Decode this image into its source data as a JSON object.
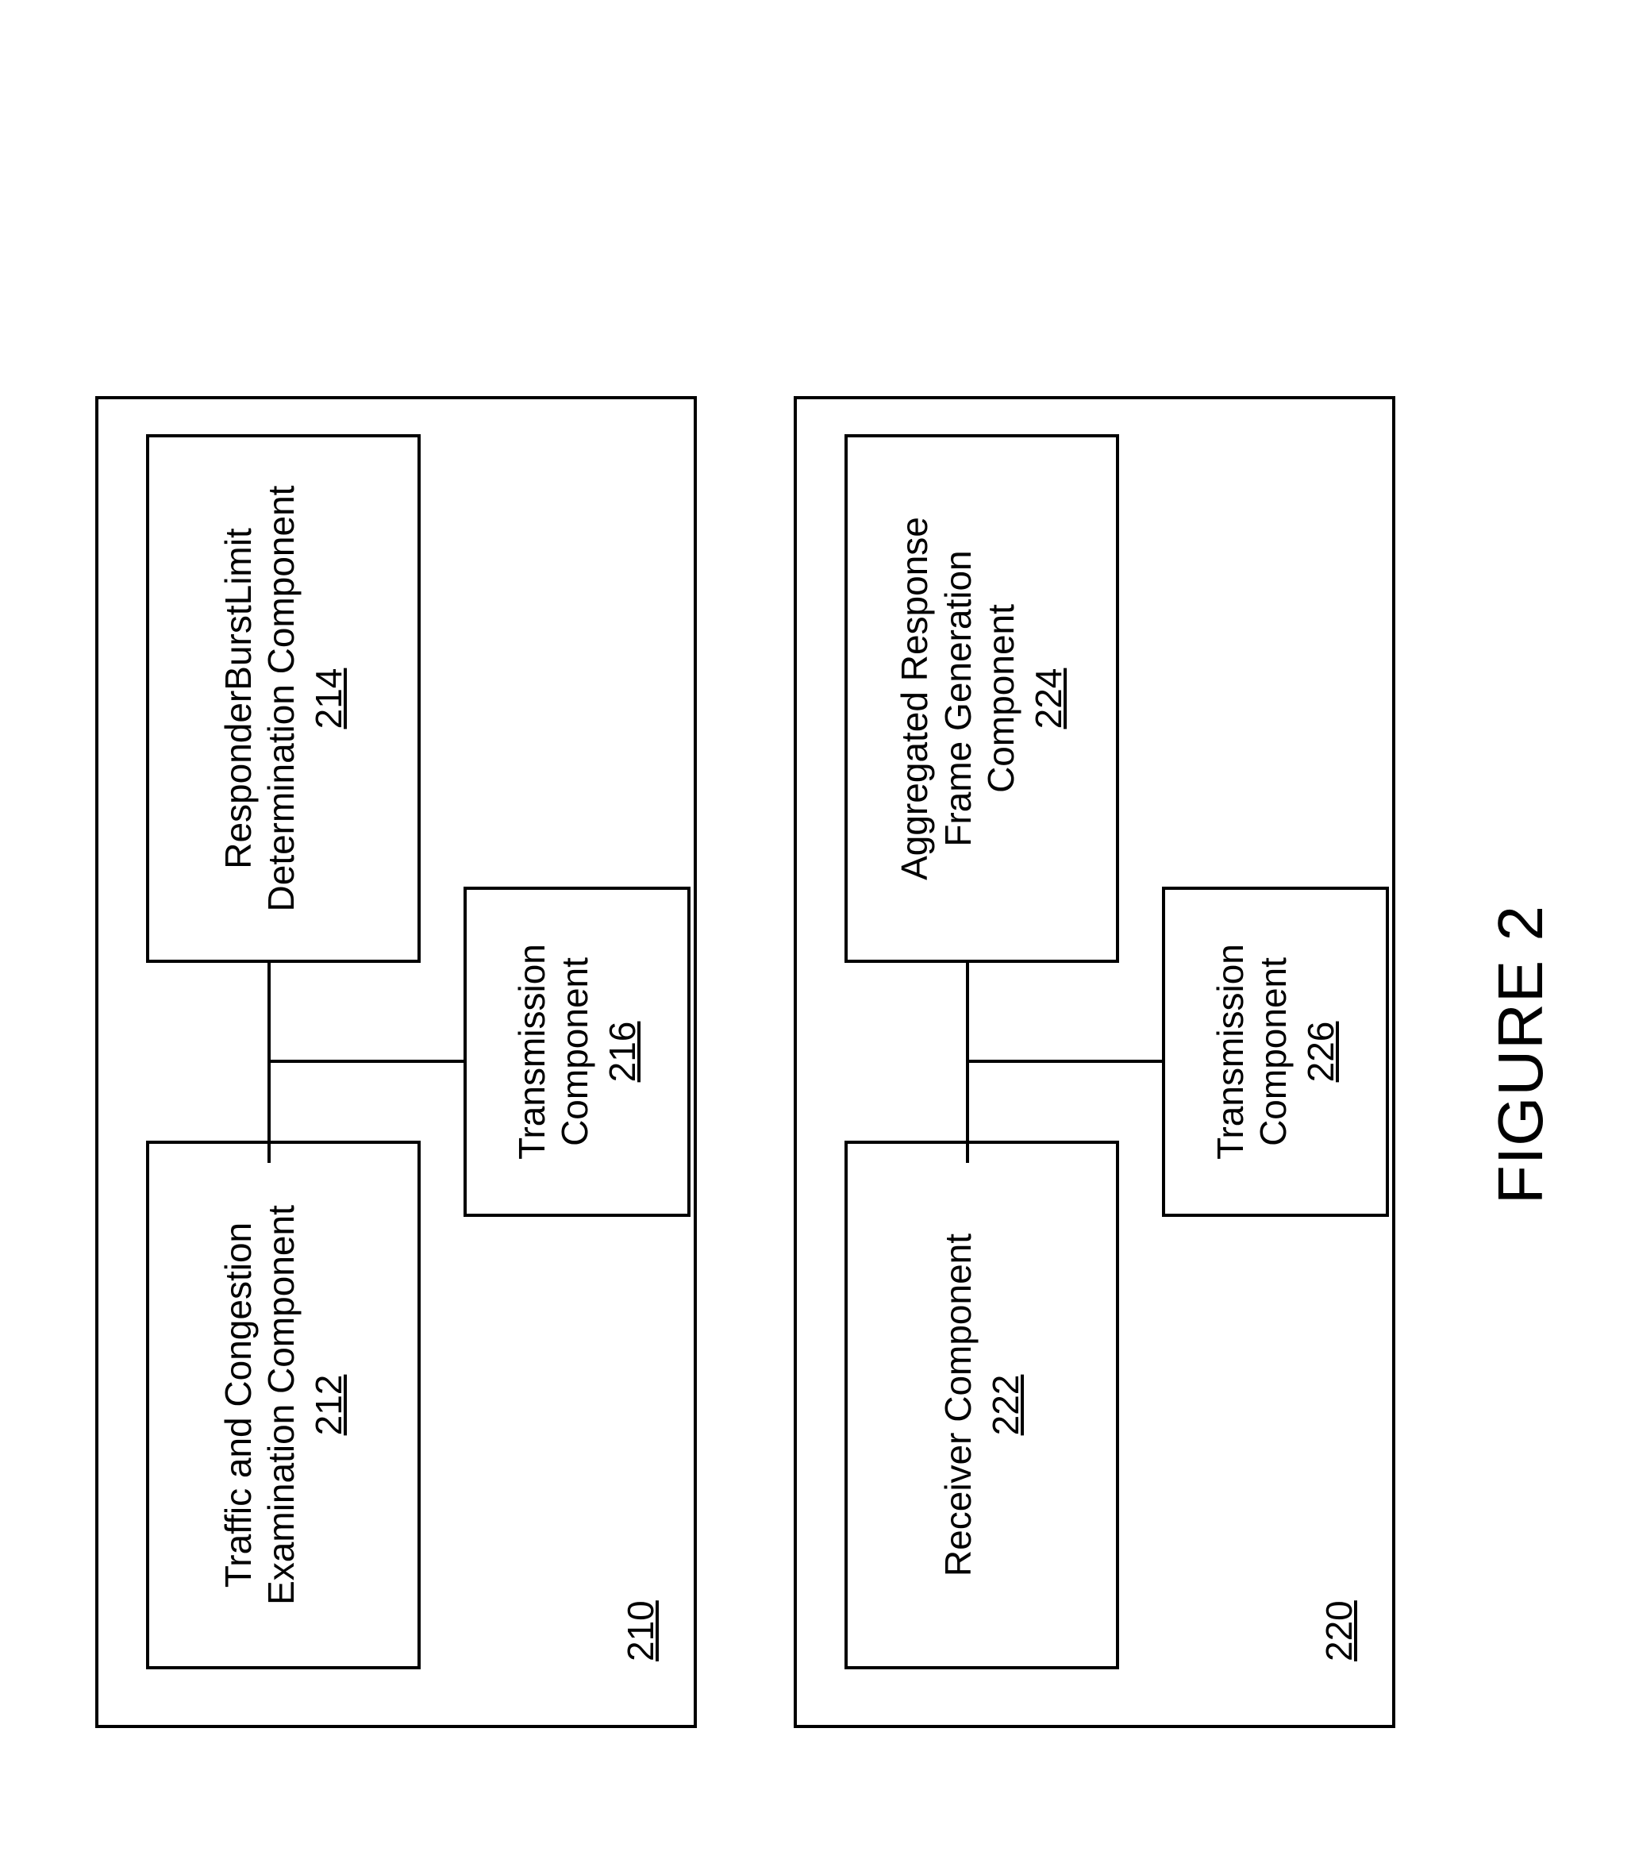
{
  "figureCaption": "FIGURE 2",
  "modules": {
    "top": {
      "ref": "210",
      "boxes": {
        "left": {
          "line1": "Traffic and Congestion",
          "line2": "Examination Component",
          "ref": "212"
        },
        "right": {
          "line1": "ResponderBurstLimit",
          "line2": "Determination Component",
          "ref": "214"
        },
        "bottom": {
          "line1": "Transmission",
          "line2": "Component",
          "ref": "216"
        }
      }
    },
    "bottom": {
      "ref": "220",
      "boxes": {
        "left": {
          "line1": "Receiver Component",
          "line2": "",
          "ref": "222"
        },
        "right": {
          "line1": "Aggregated Response",
          "line2": "Frame Generation",
          "line3": "Component",
          "ref": "224"
        },
        "bottom": {
          "line1": "Transmission",
          "line2": "Component",
          "ref": "226"
        }
      }
    }
  }
}
